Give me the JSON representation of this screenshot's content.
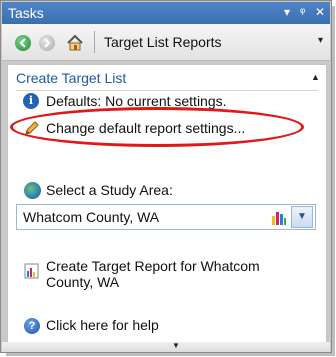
{
  "window": {
    "title": "Tasks",
    "controls": {
      "menu": "▾",
      "pin": "ᵠ",
      "close": "✕"
    }
  },
  "toolbar": {
    "title": "Target List Reports",
    "dropdown_glyph": "▾"
  },
  "section": {
    "heading": "Create Target List",
    "collapse_glyph": "▲"
  },
  "items": {
    "defaults": "Defaults: No current settings.",
    "change_settings": "Change default report settings...",
    "select_area_label": "Select a Study Area:",
    "study_area_value": "Whatcom County, WA",
    "create_report_line1": "Create Target Report for Whatcom",
    "create_report_line2": "County, WA",
    "help": "Click here for help"
  },
  "colors": {
    "accent_blue": "#1f5aa6",
    "highlight_red": "#e01818",
    "titlebar": "#4f86c8"
  }
}
